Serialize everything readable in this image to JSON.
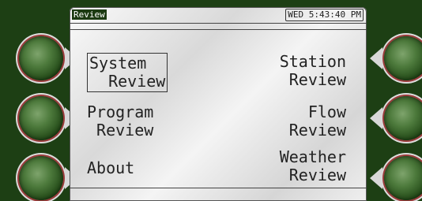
{
  "header": {
    "title": "Review",
    "clock": "WED 5:43:40 PM"
  },
  "menu": {
    "left": [
      {
        "label": "System\n  Review",
        "selected": true
      },
      {
        "label": "Program\n Review",
        "selected": false
      },
      {
        "label": "About",
        "selected": false
      }
    ],
    "right": [
      {
        "label": "Station\n Review",
        "selected": false
      },
      {
        "label": "Flow\n   Review",
        "selected": false
      },
      {
        "label": "Weather\n Review",
        "selected": false
      }
    ]
  },
  "colors": {
    "background": "#1d3f14",
    "title_tab": "#1c3a12"
  }
}
